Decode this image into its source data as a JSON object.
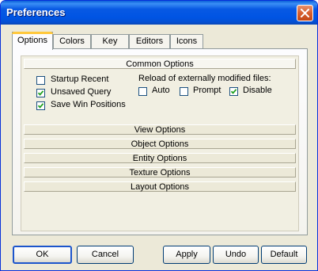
{
  "window": {
    "title": "Preferences"
  },
  "tabs": [
    {
      "label": "Options",
      "active": true
    },
    {
      "label": "Colors"
    },
    {
      "label": "Key"
    },
    {
      "label": "Editors"
    },
    {
      "label": "Icons"
    }
  ],
  "common_options": {
    "title": "Common Options",
    "checkboxes": [
      {
        "label": "Startup Recent",
        "checked": false
      },
      {
        "label": "Unsaved Query",
        "checked": true
      },
      {
        "label": "Save Win Positions",
        "checked": true
      }
    ],
    "reload_label": "Reload of externally modified files:",
    "reload_options": [
      {
        "label": "Auto",
        "checked": false
      },
      {
        "label": "Prompt",
        "checked": false
      },
      {
        "label": "Disable",
        "checked": true
      }
    ]
  },
  "sections": [
    "View Options",
    "Object Options",
    "Entity Options",
    "Texture Options",
    "Layout Options"
  ],
  "buttons": {
    "ok": "OK",
    "cancel": "Cancel",
    "apply": "Apply",
    "undo": "Undo",
    "default": "Default"
  },
  "colors": {
    "titlebar": "#0054e3",
    "dialog": "#ece9d8",
    "close": "#d65f2f",
    "tab_highlight": "#ffc83c"
  }
}
